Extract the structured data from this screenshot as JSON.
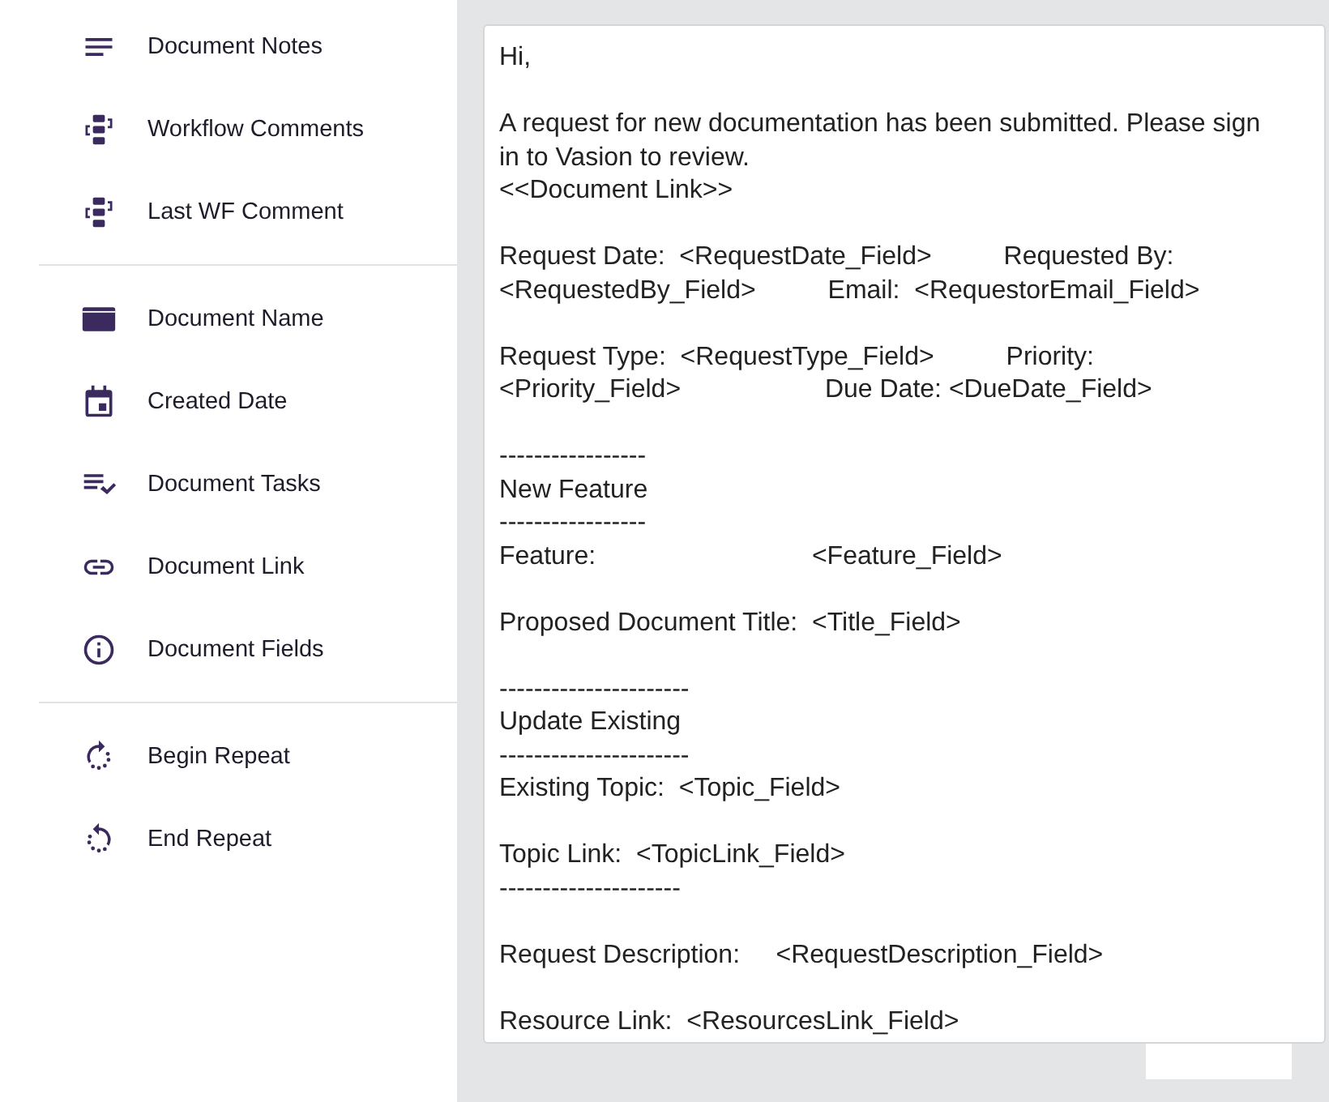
{
  "sidebar": {
    "groups": [
      {
        "items": [
          {
            "label": "Document Notes",
            "kind": "notes"
          },
          {
            "label": "Workflow Comments",
            "kind": "workflow"
          },
          {
            "label": "Last WF Comment",
            "kind": "workflow"
          }
        ]
      },
      {
        "items": [
          {
            "label": "Document Name",
            "kind": "name"
          },
          {
            "label": "Created Date",
            "kind": "date"
          },
          {
            "label": "Document Tasks",
            "kind": "tasks"
          },
          {
            "label": "Document Link",
            "kind": "link"
          },
          {
            "label": "Document Fields",
            "kind": "info"
          }
        ]
      },
      {
        "items": [
          {
            "label": "Begin Repeat",
            "kind": "begin"
          },
          {
            "label": "End Repeat",
            "kind": "end"
          }
        ]
      }
    ]
  },
  "editor": {
    "paragraphs": [
      [
        "Hi,"
      ],
      [
        "A request for new documentation has been submitted. Please sign",
        "in to Vasion to review.",
        "<<Document Link>>"
      ],
      [
        "Request Date:  <RequestDate_Field>          Requested By:",
        "<RequestedBy_Field>          Email:  <RequestorEmail_Field>"
      ],
      [
        "Request Type:  <RequestType_Field>          Priority:",
        "<Priority_Field>                    Due Date: <DueDate_Field>"
      ],
      [
        "-----------------",
        "New Feature",
        "-----------------",
        "Feature:                              <Feature_Field>"
      ],
      [
        "Proposed Document Title:  <Title_Field>"
      ],
      [
        "----------------------",
        "Update Existing",
        "----------------------",
        "Existing Topic:  <Topic_Field>"
      ],
      [
        "Topic Link:  <TopicLink_Field>",
        "---------------------"
      ],
      [
        "Request Description:     <RequestDescription_Field>"
      ],
      [
        "Resource Link:  <ResourcesLink_Field>"
      ]
    ]
  }
}
